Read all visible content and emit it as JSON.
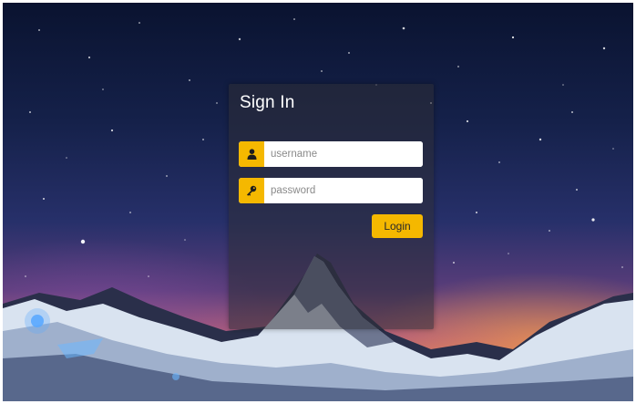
{
  "signin": {
    "title": "Sign In",
    "username": {
      "placeholder": "username",
      "value": "",
      "icon": "user-icon"
    },
    "password": {
      "placeholder": "password",
      "value": "",
      "icon": "key-icon"
    },
    "login_label": "Login"
  },
  "colors": {
    "accent": "#f5b800",
    "panel": "#2d2d37",
    "text": "#ffffff"
  }
}
